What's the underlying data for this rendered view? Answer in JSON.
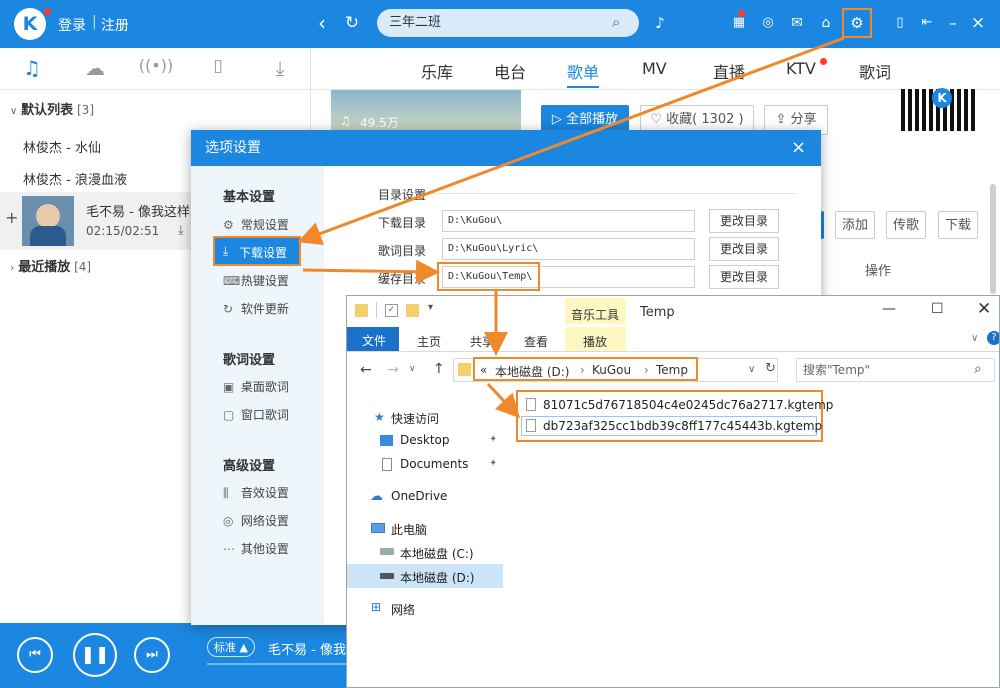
{
  "app": {
    "login": "登录",
    "register": "注册",
    "divider": "|"
  },
  "search": {
    "value": "三年二班"
  },
  "nav": {
    "tabs": [
      "乐库",
      "电台",
      "歌单",
      "MV",
      "直播",
      "KTV",
      "歌词"
    ],
    "active": "歌单"
  },
  "left_tabs": [
    "music-icon",
    "cloud-icon",
    "radio-icon",
    "phone-icon",
    "download-icon"
  ],
  "playlist": {
    "default_label": "默认列表",
    "default_count": "[3]",
    "songs": [
      "林俊杰 - 水仙",
      "林俊杰 - 浪漫血液"
    ],
    "now_title": "毛不易 - 像我这样",
    "now_time": "02:15/02:51",
    "recent_label": "最近播放",
    "recent_count": "[4]"
  },
  "banner": {
    "plays": "49.5万"
  },
  "actions": {
    "play_all": "全部播放",
    "fav": "收藏( 1302 )",
    "share": "分享"
  },
  "table": {
    "add": "添加",
    "send": "传歌",
    "download": "下载",
    "col_op": "操作"
  },
  "dialog": {
    "title": "选项设置",
    "basic_header": "基本设置",
    "basic_items": [
      "常规设置",
      "下载设置",
      "热键设置",
      "软件更新"
    ],
    "lyrics_header": "歌词设置",
    "lyrics_items": [
      "桌面歌词",
      "窗口歌词"
    ],
    "adv_header": "高级设置",
    "adv_items": [
      "音效设置",
      "网络设置",
      "其他设置"
    ],
    "section_title": "目录设置",
    "fields": [
      {
        "label": "下载目录",
        "value": "D:\\KuGou\\",
        "button": "更改目录"
      },
      {
        "label": "歌词目录",
        "value": "D:\\KuGou\\Lyric\\",
        "button": "更改目录"
      },
      {
        "label": "缓存目录",
        "value": "D:\\KuGou\\Temp\\",
        "button": "更改目录"
      }
    ]
  },
  "explorer": {
    "tool_group": "音乐工具",
    "title": "Temp",
    "ribbon": [
      "文件",
      "主页",
      "共享",
      "查看",
      "播放"
    ],
    "path": [
      "«",
      "本地磁盘 (D:)",
      "KuGou",
      "Temp"
    ],
    "search_placeholder": "搜索\"Temp\"",
    "quick_access": "快速访问",
    "nav": [
      "Desktop",
      "Documents",
      "OneDrive",
      "此电脑",
      "本地磁盘 (C:)",
      "本地磁盘 (D:)",
      "网络"
    ],
    "files": [
      "81071c5d76718504c4e0245dc76a2717.kgtemp",
      "db723af325cc1bdb39c8ff177c45443b.kgtemp"
    ]
  },
  "player": {
    "quality": "标准",
    "track": "毛不易 - 像我"
  },
  "colors": {
    "brand": "#1b87e0",
    "highlight": "#f0892b",
    "dialog_side": "#eef5fb"
  }
}
